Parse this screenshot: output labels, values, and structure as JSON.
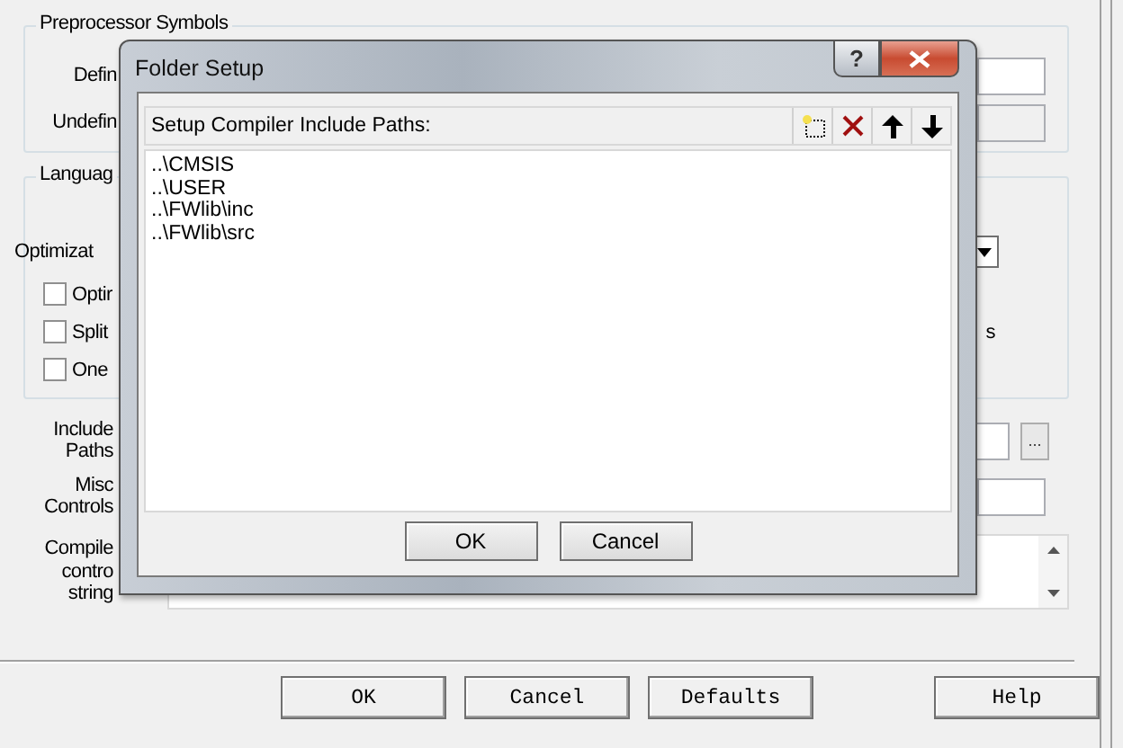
{
  "options_dialog": {
    "preprocessor": {
      "title": "Preprocessor Symbols",
      "define_label": "Defin",
      "undefine_label": "Undefin",
      "undefine_disabled": true
    },
    "language": {
      "title": "Languag",
      "optimization_label": "Optimizat",
      "options": [
        {
          "label": "Optir",
          "checked": false
        },
        {
          "label": "Split",
          "checked": false
        },
        {
          "label": "One",
          "checked": false
        }
      ],
      "side_text": "s"
    },
    "include_paths_label": [
      "Include",
      "Paths"
    ],
    "browse_button": "...",
    "misc_controls_label": [
      "Misc",
      "Controls"
    ],
    "compiler_string_label": [
      "Compile",
      "contro",
      "string"
    ],
    "buttons": [
      "OK",
      "Cancel",
      "Defaults",
      "Help"
    ]
  },
  "folder_setup": {
    "title": "Folder Setup",
    "help_button": "?",
    "list_label": "Setup Compiler Include Paths:",
    "paths": [
      "..\\CMSIS",
      "..\\USER",
      "..\\FWlib\\inc",
      "..\\FWlib\\src"
    ],
    "buttons": [
      "OK",
      "Cancel"
    ]
  }
}
